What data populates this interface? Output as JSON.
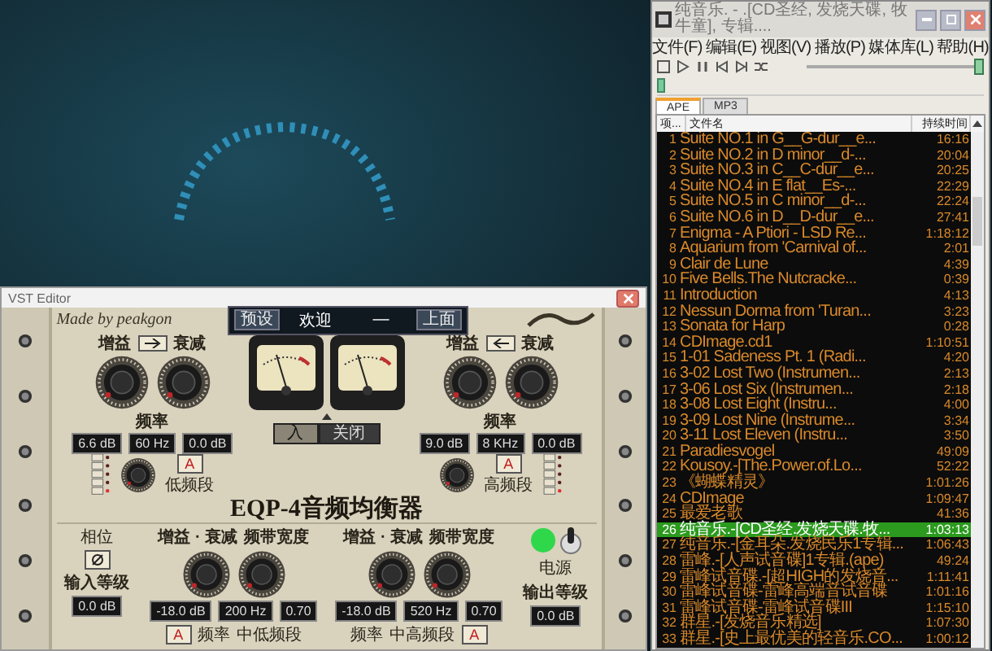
{
  "playlist_window": {
    "title": "纯音乐. - .[CD圣经, 发烧天碟, 牧牛童], 专辑....",
    "menu": [
      "文件(F)",
      "编辑(E)",
      "视图(V)",
      "播放(P)",
      "媒体库(L)",
      "帮助(H)"
    ],
    "volume": {
      "level": 1
    },
    "seek": {
      "level": 0
    },
    "tabs": [
      {
        "label": "APE",
        "selected": true
      },
      {
        "label": "MP3",
        "selected": false
      }
    ],
    "columns": [
      "项...",
      "文件名",
      "持续时间"
    ],
    "rows": [
      {
        "number": "1",
        "name": "Suite NO.1 in G__G-dur__e...",
        "duration": "16:16",
        "selected": false
      },
      {
        "number": "2",
        "name": "Suite NO.2 in D minor__d-...",
        "duration": "20:04",
        "selected": false
      },
      {
        "number": "3",
        "name": "Suite NO.3 in C__C-dur__e...",
        "duration": "20:25",
        "selected": false
      },
      {
        "number": "4",
        "name": "Suite NO.4 in E flat__Es-...",
        "duration": "22:29",
        "selected": false
      },
      {
        "number": "5",
        "name": "Suite NO.5 in C minor__d-...",
        "duration": "22:24",
        "selected": false
      },
      {
        "number": "6",
        "name": "Suite NO.6 in D__D-dur__e...",
        "duration": "27:41",
        "selected": false
      },
      {
        "number": "7",
        "name": "Enigma - A Ptiori - LSD Re...",
        "duration": "1:18:12",
        "selected": false
      },
      {
        "number": "8",
        "name": "Aquarium from 'Carnival of...",
        "duration": "2:01",
        "selected": false
      },
      {
        "number": "9",
        "name": "Clair de Lune",
        "duration": "4:39",
        "selected": false
      },
      {
        "number": "10",
        "name": "Five Bells.The Nutcracke...",
        "duration": "0:39",
        "selected": false
      },
      {
        "number": "11",
        "name": "Introduction",
        "duration": "4:13",
        "selected": false
      },
      {
        "number": "12",
        "name": "Nessun Dorma from 'Turan...",
        "duration": "3:23",
        "selected": false
      },
      {
        "number": "13",
        "name": "Sonata for Harp",
        "duration": "0:28",
        "selected": false
      },
      {
        "number": "14",
        "name": "CDImage.cd1",
        "duration": "1:10:51",
        "selected": false
      },
      {
        "number": "15",
        "name": "1-01 Sadeness Pt. 1 (Radi...",
        "duration": "4:20",
        "selected": false
      },
      {
        "number": "16",
        "name": "3-02 Lost Two (Instrumen...",
        "duration": "2:13",
        "selected": false
      },
      {
        "number": "17",
        "name": "3-06 Lost Six (Instrumen...",
        "duration": "2:18",
        "selected": false
      },
      {
        "number": "18",
        "name": "3-08 Lost Eight (Instru...",
        "duration": "4:00",
        "selected": false
      },
      {
        "number": "19",
        "name": "3-09 Lost Nine (Instrume...",
        "duration": "3:34",
        "selected": false
      },
      {
        "number": "20",
        "name": "3-11 Lost Eleven (Instru...",
        "duration": "3:50",
        "selected": false
      },
      {
        "number": "21",
        "name": "Paradiesvogel",
        "duration": "49:09",
        "selected": false
      },
      {
        "number": "22",
        "name": "Kousoy.-[The.Power.of.Lo...",
        "duration": "52:22",
        "selected": false
      },
      {
        "number": "23",
        "name": "《蝴蝶精灵》",
        "duration": "1:01:26",
        "selected": false
      },
      {
        "number": "24",
        "name": "CDImage",
        "duration": "1:09:47",
        "selected": false
      },
      {
        "number": "25",
        "name": "最爱老歌",
        "duration": "41:36",
        "selected": false
      },
      {
        "number": "26",
        "name": "纯音乐.-[CD圣经.发烧天碟.牧...",
        "duration": "1:03:13",
        "selected": true
      },
      {
        "number": "27",
        "name": "纯音乐.-[金耳朵.发烧民乐1专辑...",
        "duration": "1:06:43",
        "selected": false
      },
      {
        "number": "28",
        "name": "雷峰.-[人声试音碟]1专辑.(ape)",
        "duration": "49:24",
        "selected": false
      },
      {
        "number": "29",
        "name": "雷峰试音碟.-[超HIGH的发烧音...",
        "duration": "1:11:41",
        "selected": false
      },
      {
        "number": "30",
        "name": "雷峰试音碟-雷峰高端音试音碟",
        "duration": "1:01:16",
        "selected": false
      },
      {
        "number": "31",
        "name": "雷峰试音碟-雷峰试音碟III",
        "duration": "1:15:10",
        "selected": false
      },
      {
        "number": "32",
        "name": "群星.-[发烧音乐精选]",
        "duration": "1:07:30",
        "selected": false
      },
      {
        "number": "33",
        "name": "群星.-[史上最优美的轻音乐.CO...",
        "duration": "1:00:12",
        "selected": false
      }
    ]
  },
  "vst_window": {
    "title": "VST Editor",
    "credit": "Made by peakgon",
    "preset_bar": {
      "preset_button": "预设",
      "name": "欢迎",
      "dash": "—",
      "tools_button": "上面"
    },
    "low_band": {
      "gain_label": "增益",
      "cut_label": "衰减",
      "freq_label": "频率",
      "values": [
        "6.6 dB",
        "60 Hz",
        "0.0 dB"
      ],
      "mode_button": "A",
      "mode_label": "低频段"
    },
    "meter_switch": {
      "options": [
        {
          "label": "入",
          "selected": true
        },
        {
          "label": "关闭",
          "selected": false
        }
      ]
    },
    "high_band": {
      "gain_label": "增益",
      "cut_label": "衰减",
      "freq_label": "频率",
      "values": [
        "9.0 dB",
        "8 KHz",
        "0.0 dB"
      ],
      "mode_button": "A",
      "mode_label": "高频段"
    },
    "product_title": "EQP-4音频均衡器",
    "phase": {
      "label": "相位"
    },
    "input": {
      "label": "输入等级",
      "value": "0.0 dB"
    },
    "mid_low_band": {
      "gain_label": "增益 · 衰减",
      "width_label": "频带宽度",
      "values": [
        "-18.0 dB",
        "200 Hz",
        "0.70"
      ],
      "freq_label": "频率",
      "mode_button": "A",
      "mode_label": "中低频段"
    },
    "mid_high_band": {
      "gain_label": "增益 · 衰减",
      "width_label": "频带宽度",
      "values": [
        "-18.0 dB",
        "520 Hz",
        "0.70"
      ],
      "freq_label": "频率",
      "mode_button": "A",
      "mode_label": "中高频段"
    },
    "power": {
      "label": "电源",
      "on": true
    },
    "output": {
      "label": "输出等级",
      "value": "0.0 dB"
    }
  }
}
